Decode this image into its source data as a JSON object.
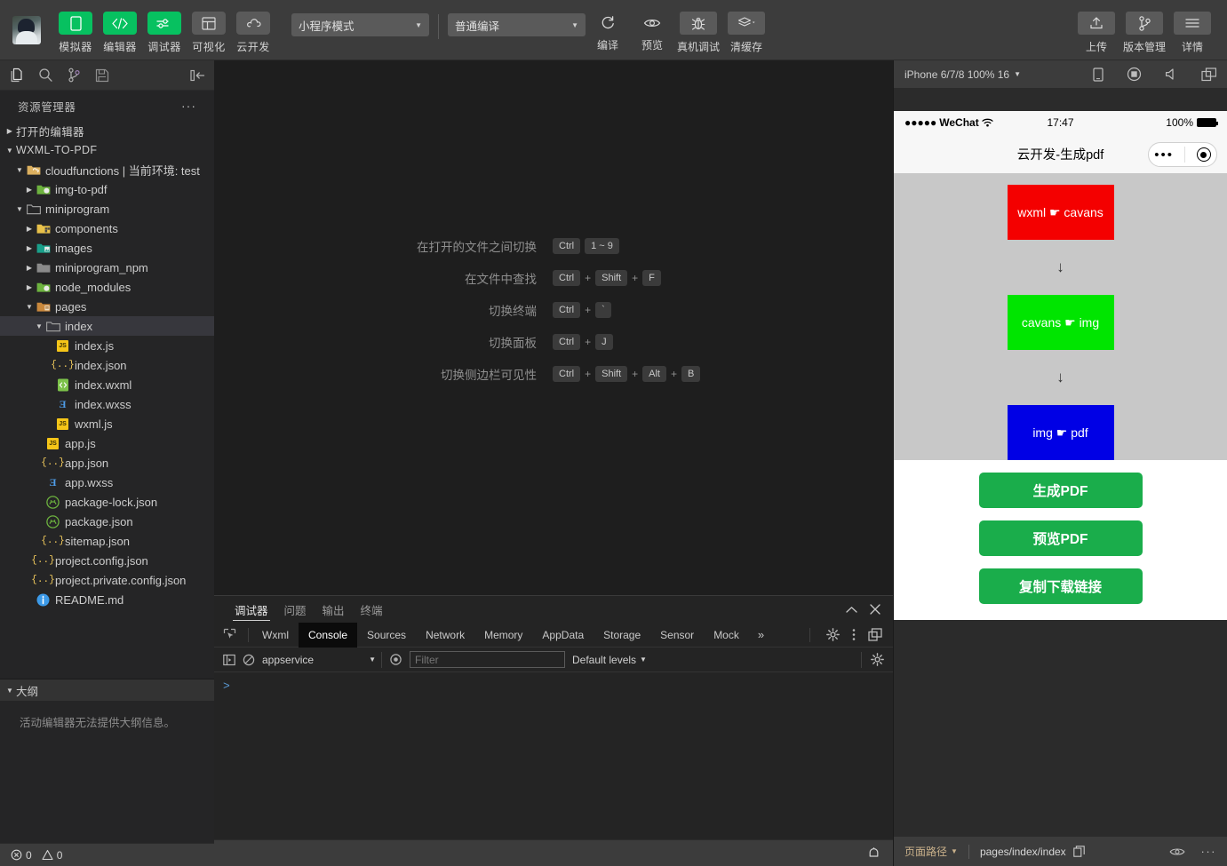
{
  "toolbar": {
    "main_buttons": [
      {
        "label": "模拟器",
        "icon": "phone-icon",
        "style": "green"
      },
      {
        "label": "编辑器",
        "icon": "code-icon",
        "style": "green"
      },
      {
        "label": "调试器",
        "icon": "sliders-icon",
        "style": "green"
      },
      {
        "label": "可视化",
        "icon": "layout-icon",
        "style": "grey"
      },
      {
        "label": "云开发",
        "icon": "cloud-icon",
        "style": "grey"
      }
    ],
    "mode_select": "小程序模式",
    "compile_select": "普通编译",
    "compile_actions": [
      {
        "label": "编译",
        "icon": "refresh-icon"
      },
      {
        "label": "预览",
        "icon": "eye-icon"
      }
    ],
    "box_actions": [
      {
        "label": "真机调试",
        "icon": "bug-icon"
      },
      {
        "label": "清缓存",
        "icon": "layers-icon"
      }
    ],
    "right_buttons": [
      {
        "label": "上传",
        "icon": "upload-icon"
      },
      {
        "label": "版本管理",
        "icon": "branch-icon"
      },
      {
        "label": "详情",
        "icon": "menu-icon"
      }
    ]
  },
  "sidebar": {
    "activity_icons": [
      "files-icon",
      "search-icon",
      "source-control-icon",
      "save-icon",
      "collapse-sidebar-icon"
    ],
    "title": "资源管理器",
    "more_label": "···",
    "tree": [
      {
        "label": "打开的编辑器",
        "depth": 0,
        "twist": "collapsed",
        "icon": "none",
        "kind": "header"
      },
      {
        "label": "WXML-TO-PDF",
        "depth": 0,
        "twist": "expanded",
        "icon": "none",
        "kind": "header"
      },
      {
        "label": "cloudfunctions | 当前环境: test",
        "depth": 1,
        "twist": "expanded",
        "icon": "folder-cloud",
        "kind": "folder"
      },
      {
        "label": "img-to-pdf",
        "depth": 2,
        "twist": "collapsed",
        "icon": "folder-node",
        "kind": "folder"
      },
      {
        "label": "miniprogram",
        "depth": 1,
        "twist": "expanded",
        "icon": "folder-open-grey",
        "kind": "folder"
      },
      {
        "label": "components",
        "depth": 2,
        "twist": "collapsed",
        "icon": "folder-components",
        "kind": "folder"
      },
      {
        "label": "images",
        "depth": 2,
        "twist": "collapsed",
        "icon": "folder-images",
        "kind": "folder"
      },
      {
        "label": "miniprogram_npm",
        "depth": 2,
        "twist": "collapsed",
        "icon": "folder-grey",
        "kind": "folder"
      },
      {
        "label": "node_modules",
        "depth": 2,
        "twist": "collapsed",
        "icon": "folder-node",
        "kind": "folder"
      },
      {
        "label": "pages",
        "depth": 2,
        "twist": "expanded",
        "icon": "folder-pages",
        "kind": "folder"
      },
      {
        "label": "index",
        "depth": 3,
        "twist": "expanded",
        "icon": "folder-open-grey",
        "kind": "folder",
        "selected": true
      },
      {
        "label": "index.js",
        "depth": 4,
        "twist": "none",
        "icon": "js",
        "kind": "file"
      },
      {
        "label": "index.json",
        "depth": 4,
        "twist": "none",
        "icon": "json",
        "kind": "file"
      },
      {
        "label": "index.wxml",
        "depth": 4,
        "twist": "none",
        "icon": "wxml",
        "kind": "file"
      },
      {
        "label": "index.wxss",
        "depth": 4,
        "twist": "none",
        "icon": "wxss",
        "kind": "file"
      },
      {
        "label": "wxml.js",
        "depth": 4,
        "twist": "none",
        "icon": "js",
        "kind": "file"
      },
      {
        "label": "app.js",
        "depth": 3,
        "twist": "none",
        "icon": "js",
        "kind": "file"
      },
      {
        "label": "app.json",
        "depth": 3,
        "twist": "none",
        "icon": "json",
        "kind": "file"
      },
      {
        "label": "app.wxss",
        "depth": 3,
        "twist": "none",
        "icon": "wxss",
        "kind": "file"
      },
      {
        "label": "package-lock.json",
        "depth": 3,
        "twist": "none",
        "icon": "npm",
        "kind": "file"
      },
      {
        "label": "package.json",
        "depth": 3,
        "twist": "none",
        "icon": "npm",
        "kind": "file"
      },
      {
        "label": "sitemap.json",
        "depth": 3,
        "twist": "none",
        "icon": "json",
        "kind": "file"
      },
      {
        "label": "project.config.json",
        "depth": 2,
        "twist": "none",
        "icon": "json",
        "kind": "file"
      },
      {
        "label": "project.private.config.json",
        "depth": 2,
        "twist": "none",
        "icon": "json",
        "kind": "file"
      },
      {
        "label": "README.md",
        "depth": 2,
        "twist": "none",
        "icon": "md",
        "kind": "file"
      }
    ],
    "outline_title": "大纲",
    "outline_message": "活动编辑器无法提供大纲信息。",
    "status_errors": "0",
    "status_warnings": "0"
  },
  "editor": {
    "shortcuts": [
      {
        "name": "在打开的文件之间切换",
        "keys": [
          "Ctrl",
          "1 ~ 9"
        ],
        "separators": []
      },
      {
        "name": "在文件中查找",
        "keys": [
          "Ctrl",
          "Shift",
          "F"
        ],
        "separators": [
          "+",
          "+"
        ]
      },
      {
        "name": "切换终端",
        "keys": [
          "Ctrl",
          "`"
        ],
        "separators": [
          "+"
        ]
      },
      {
        "name": "切换面板",
        "keys": [
          "Ctrl",
          "J"
        ],
        "separators": [
          "+"
        ]
      },
      {
        "name": "切换侧边栏可见性",
        "keys": [
          "Ctrl",
          "Shift",
          "Alt",
          "B"
        ],
        "separators": [
          "+",
          "+",
          "+"
        ]
      }
    ]
  },
  "debugger": {
    "panel_tabs": [
      {
        "label": "调试器",
        "active": true
      },
      {
        "label": "问题",
        "active": false
      },
      {
        "label": "输出",
        "active": false
      },
      {
        "label": "终端",
        "active": false
      }
    ],
    "panel_controls": [
      "chevron-up-icon",
      "close-icon"
    ],
    "devtools_tabs": [
      {
        "label": "Wxml",
        "active": false
      },
      {
        "label": "Console",
        "active": true
      },
      {
        "label": "Sources",
        "active": false
      },
      {
        "label": "Network",
        "active": false
      },
      {
        "label": "Memory",
        "active": false
      },
      {
        "label": "AppData",
        "active": false
      },
      {
        "label": "Storage",
        "active": false
      },
      {
        "label": "Sensor",
        "active": false
      },
      {
        "label": "Mock",
        "active": false
      }
    ],
    "devtools_more": "»",
    "console": {
      "context": "appservice",
      "filter_placeholder": "Filter",
      "filter_value": "",
      "levels": "Default levels",
      "prompt": ">"
    }
  },
  "simulator": {
    "device": "iPhone 6/7/8 100% 16",
    "top_icons": [
      "rotate-device-icon",
      "record-icon",
      "volume-icon",
      "multiwindow-icon"
    ],
    "phone": {
      "carrier": "WeChat",
      "signal_dots": "●●●●●",
      "time": "17:47",
      "battery_percent": "100%",
      "nav_title": "云开发-生成pdf",
      "flow": [
        {
          "text": "wxml ☛ cavans",
          "color": "#f40000"
        },
        {
          "text": "cavans ☛ img",
          "color": "#00e500"
        },
        {
          "text": "img ☛ pdf",
          "color": "#0000e5"
        }
      ],
      "flow_arrow": "↓",
      "buttons": [
        {
          "label": "生成PDF",
          "color": "#1aad4b"
        },
        {
          "label": "预览PDF",
          "color": "#1aad4b"
        },
        {
          "label": "复制下载链接",
          "color": "#1aad4b"
        }
      ]
    },
    "bottom": {
      "path_label": "页面路径",
      "path_value": "pages/index/index",
      "copy_icon": "copy-icon",
      "right_icons": [
        "eye-icon",
        "more-icon"
      ]
    }
  }
}
